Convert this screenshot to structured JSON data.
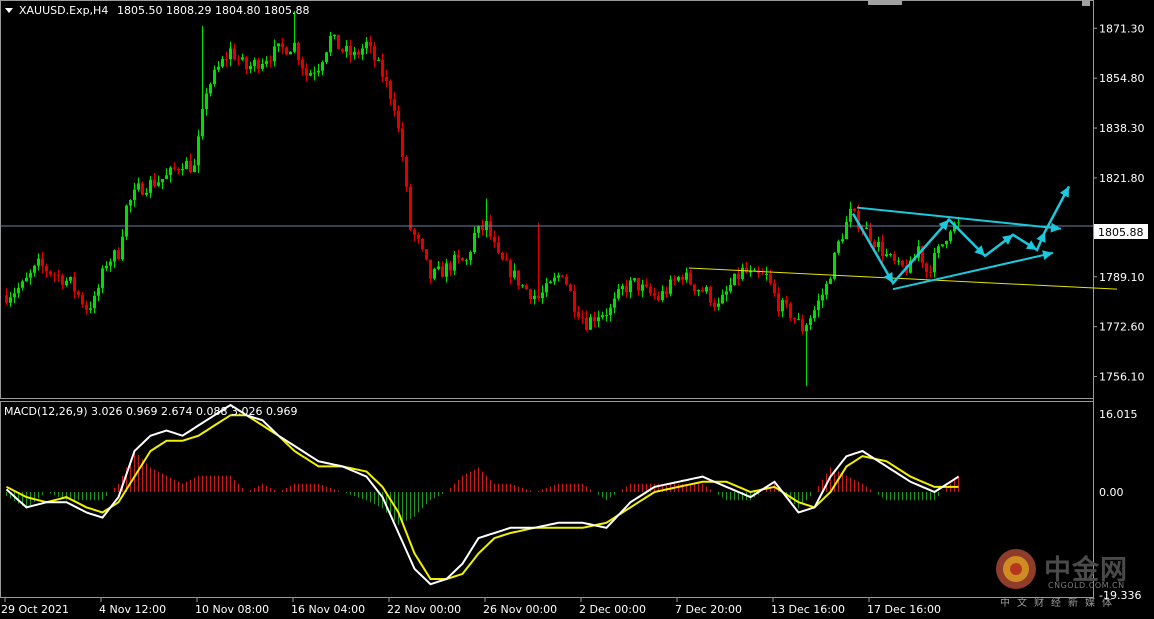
{
  "header": {
    "symbol": "XAUUSD.Exp,H4",
    "ohlc": "1805.50 1808.29 1804.80 1805.88"
  },
  "macd_header": "MACD(12,26,9) 3.026 0.969 2.674 0.088 3.026 0.969",
  "current_price_label": "1805.88",
  "macd_min_label": "-19.336",
  "logo": {
    "cn": "中金网",
    "en": "CNGOLD.COM.CN",
    "sub": "中文财经新媒体"
  },
  "colors": {
    "bull": "#00e000",
    "bear": "#e00000",
    "trend_yellow": "#e6e600",
    "arrow_cyan": "#1ec8dc",
    "macd_white": "#ffffff",
    "macd_yellow": "#f0f000",
    "hist_pos": "#c81e1e",
    "hist_neg": "#1e961e",
    "price_line": "#6e7fa0"
  },
  "chart_data": [
    {
      "type": "candlestick",
      "title": "XAUUSD.Exp,H4",
      "y_ticks": [
        "1871.30",
        "1854.80",
        "1838.30",
        "1821.80",
        "1805.88",
        "1789.10",
        "1772.60",
        "1756.10"
      ],
      "y_tick_values": [
        1871.3,
        1854.8,
        1838.3,
        1821.8,
        1805.88,
        1789.1,
        1772.6,
        1756.1
      ],
      "ylim": [
        1749,
        1880
      ],
      "x_ticks": [
        "29 Oct 2021",
        "4 Nov 12:00",
        "10 Nov 08:00",
        "16 Nov 04:00",
        "22 Nov 00:00",
        "26 Nov 00:00",
        "2 Dec 00:00",
        "7 Dec 20:00",
        "13 Dec 16:00",
        "17 Dec 16:00"
      ],
      "x_tick_index": [
        0,
        24,
        48,
        72,
        96,
        120,
        144,
        168,
        192,
        216
      ],
      "n_bars": 239,
      "close_path": [
        [
          0,
          1783
        ],
        [
          4,
          1786
        ],
        [
          8,
          1793
        ],
        [
          12,
          1790
        ],
        [
          16,
          1787
        ],
        [
          20,
          1779
        ],
        [
          22,
          1781
        ],
        [
          25,
          1794
        ],
        [
          28,
          1797
        ],
        [
          30,
          1812
        ],
        [
          33,
          1818
        ],
        [
          36,
          1820
        ],
        [
          40,
          1822
        ],
        [
          44,
          1827
        ],
        [
          47,
          1825
        ],
        [
          50,
          1851
        ],
        [
          53,
          1858
        ],
        [
          56,
          1864
        ],
        [
          60,
          1858
        ],
        [
          64,
          1861
        ],
        [
          68,
          1864
        ],
        [
          72,
          1866
        ],
        [
          75,
          1856
        ],
        [
          78,
          1859
        ],
        [
          81,
          1868
        ],
        [
          84,
          1864
        ],
        [
          87,
          1862
        ],
        [
          90,
          1866
        ],
        [
          94,
          1856
        ],
        [
          97,
          1846
        ],
        [
          99,
          1829
        ],
        [
          101,
          1805
        ],
        [
          103,
          1800
        ],
        [
          106,
          1789
        ],
        [
          109,
          1791
        ],
        [
          112,
          1794
        ],
        [
          115,
          1794
        ],
        [
          117,
          1803
        ],
        [
          120,
          1806
        ],
        [
          123,
          1795
        ],
        [
          126,
          1791
        ],
        [
          129,
          1786
        ],
        [
          133,
          1782
        ],
        [
          136,
          1786
        ],
        [
          139,
          1791
        ],
        [
          142,
          1780
        ],
        [
          145,
          1774
        ],
        [
          148,
          1777
        ],
        [
          151,
          1778
        ],
        [
          154,
          1785
        ],
        [
          157,
          1787
        ],
        [
          160,
          1784
        ],
        [
          163,
          1782
        ],
        [
          166,
          1786
        ],
        [
          169,
          1790
        ],
        [
          172,
          1786
        ],
        [
          175,
          1784
        ],
        [
          178,
          1779
        ],
        [
          181,
          1786
        ],
        [
          184,
          1791
        ],
        [
          187,
          1789
        ],
        [
          190,
          1789
        ],
        [
          193,
          1780
        ],
        [
          196,
          1777
        ],
        [
          199,
          1772
        ],
        [
          202,
          1778
        ],
        [
          205,
          1786
        ],
        [
          208,
          1800
        ],
        [
          211,
          1810
        ],
        [
          214,
          1806
        ],
        [
          217,
          1801
        ],
        [
          220,
          1796
        ],
        [
          223,
          1792
        ],
        [
          226,
          1792
        ],
        [
          228,
          1799
        ],
        [
          230,
          1791
        ],
        [
          232,
          1795
        ],
        [
          234,
          1800
        ],
        [
          236,
          1806
        ],
        [
          238,
          1806
        ]
      ],
      "spikes": [
        {
          "index": 49,
          "high": 1872
        },
        {
          "index": 72,
          "high": 1877
        },
        {
          "index": 120,
          "high": 1815
        },
        {
          "index": 133,
          "high": 1807
        },
        {
          "index": 200,
          "low": 1753
        },
        {
          "index": 213,
          "high": 1813
        }
      ],
      "trendlines": [
        {
          "color": "yellow",
          "from": [
            171,
            1792
          ],
          "to": [
            278,
            1785
          ]
        },
        {
          "color": "cyan",
          "from": [
            213,
            1812
          ],
          "to": [
            264,
            1805
          ]
        },
        {
          "color": "cyan",
          "from": [
            222,
            1785
          ],
          "to": [
            262,
            1797
          ]
        }
      ],
      "zigzag": [
        [
          212,
          1810
        ],
        [
          222,
          1787
        ],
        [
          236,
          1808
        ],
        [
          245,
          1796
        ],
        [
          252,
          1803
        ],
        [
          258,
          1798
        ],
        [
          260,
          1804
        ],
        [
          266,
          1819
        ]
      ]
    },
    {
      "type": "macd",
      "title": "MACD(12,26,9) 3.026 0.969 2.674 0.088 3.026 0.969",
      "params": [
        12,
        26,
        9
      ],
      "values": [
        3.026,
        0.969,
        2.674,
        0.088,
        3.026,
        0.969
      ],
      "y_ticks": [
        "16.015",
        "0.00",
        "-19.336"
      ],
      "ylim": [
        -19.336,
        16.015
      ],
      "macd_line": [
        [
          0,
          0.5
        ],
        [
          5,
          -3
        ],
        [
          10,
          -2
        ],
        [
          15,
          -2
        ],
        [
          20,
          -4
        ],
        [
          24,
          -5
        ],
        [
          28,
          -1
        ],
        [
          32,
          8
        ],
        [
          36,
          11
        ],
        [
          40,
          12
        ],
        [
          44,
          11
        ],
        [
          48,
          13
        ],
        [
          52,
          15
        ],
        [
          56,
          17
        ],
        [
          60,
          15
        ],
        [
          64,
          14
        ],
        [
          68,
          11
        ],
        [
          72,
          9
        ],
        [
          78,
          6
        ],
        [
          84,
          5
        ],
        [
          90,
          3
        ],
        [
          94,
          -1
        ],
        [
          98,
          -8
        ],
        [
          102,
          -15
        ],
        [
          106,
          -18
        ],
        [
          110,
          -17
        ],
        [
          114,
          -14
        ],
        [
          118,
          -9
        ],
        [
          122,
          -8
        ],
        [
          126,
          -7
        ],
        [
          132,
          -7
        ],
        [
          138,
          -6
        ],
        [
          144,
          -6
        ],
        [
          150,
          -7
        ],
        [
          156,
          -2
        ],
        [
          162,
          1
        ],
        [
          168,
          2
        ],
        [
          174,
          3
        ],
        [
          180,
          1
        ],
        [
          186,
          -1
        ],
        [
          192,
          2
        ],
        [
          198,
          -4
        ],
        [
          202,
          -3
        ],
        [
          206,
          3
        ],
        [
          210,
          7
        ],
        [
          214,
          8
        ],
        [
          220,
          5
        ],
        [
          226,
          2
        ],
        [
          232,
          0
        ],
        [
          238,
          3
        ]
      ],
      "signal_line": [
        [
          0,
          1
        ],
        [
          5,
          -1
        ],
        [
          10,
          -2
        ],
        [
          15,
          -1
        ],
        [
          20,
          -3
        ],
        [
          24,
          -4
        ],
        [
          28,
          -2
        ],
        [
          32,
          3
        ],
        [
          36,
          8
        ],
        [
          40,
          10
        ],
        [
          44,
          10
        ],
        [
          48,
          11
        ],
        [
          52,
          13
        ],
        [
          56,
          15
        ],
        [
          60,
          15
        ],
        [
          64,
          13
        ],
        [
          68,
          11
        ],
        [
          72,
          8
        ],
        [
          78,
          5
        ],
        [
          84,
          5
        ],
        [
          90,
          4
        ],
        [
          94,
          1
        ],
        [
          98,
          -4
        ],
        [
          102,
          -12
        ],
        [
          106,
          -17
        ],
        [
          110,
          -17
        ],
        [
          114,
          -16
        ],
        [
          118,
          -12
        ],
        [
          122,
          -9
        ],
        [
          126,
          -8
        ],
        [
          132,
          -7
        ],
        [
          138,
          -7
        ],
        [
          144,
          -7
        ],
        [
          150,
          -6
        ],
        [
          156,
          -3
        ],
        [
          162,
          0
        ],
        [
          168,
          1
        ],
        [
          174,
          2
        ],
        [
          180,
          2
        ],
        [
          186,
          0
        ],
        [
          192,
          1
        ],
        [
          198,
          -2
        ],
        [
          202,
          -3
        ],
        [
          206,
          0
        ],
        [
          210,
          5
        ],
        [
          214,
          7
        ],
        [
          220,
          6
        ],
        [
          226,
          3
        ],
        [
          232,
          1
        ],
        [
          238,
          1
        ]
      ]
    }
  ]
}
